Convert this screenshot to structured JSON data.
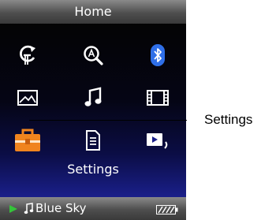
{
  "header": {
    "title": "Home"
  },
  "menu": {
    "selected_label": "Settings",
    "items": [
      {
        "id": "intelligent-shuffle",
        "icon": "shuffle-icon"
      },
      {
        "id": "search",
        "icon": "search-icon"
      },
      {
        "id": "bluetooth",
        "icon": "bluetooth-icon"
      },
      {
        "id": "photo",
        "icon": "photo-icon"
      },
      {
        "id": "music",
        "icon": "music-note-icon"
      },
      {
        "id": "video",
        "icon": "film-icon"
      },
      {
        "id": "settings",
        "icon": "toolbox-icon",
        "selected": true
      },
      {
        "id": "playlist",
        "icon": "document-icon"
      },
      {
        "id": "now-playing",
        "icon": "now-playing-icon"
      }
    ]
  },
  "status": {
    "track": "Blue Sky"
  },
  "annotation": {
    "label": "Settings"
  },
  "colors": {
    "accent_green": "#35c43a",
    "selected_orange": "#f0841e",
    "bluetooth_blue": "#2f6fe8"
  }
}
